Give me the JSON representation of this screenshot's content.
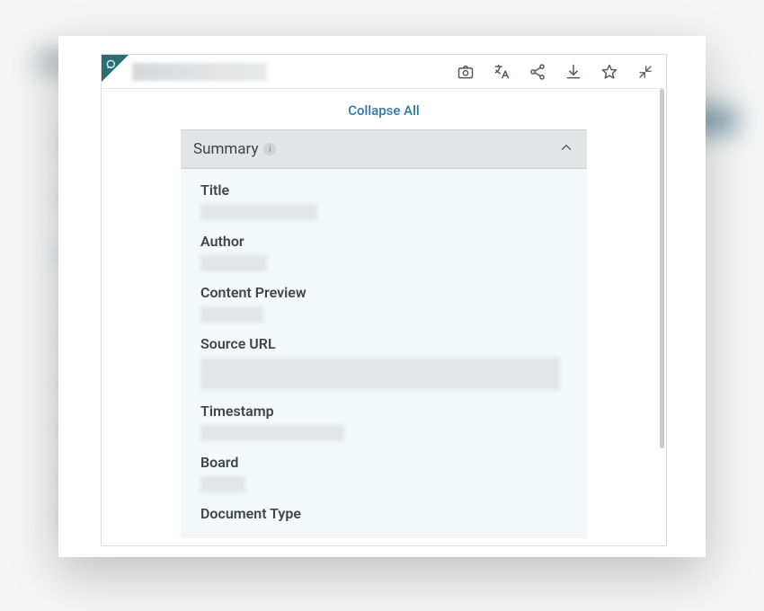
{
  "toolbar": {
    "collapse_label": "Collapse All"
  },
  "section": {
    "title": "Summary",
    "fields": [
      {
        "label": "Title"
      },
      {
        "label": "Author"
      },
      {
        "label": "Content Preview"
      },
      {
        "label": "Source URL"
      },
      {
        "label": "Timestamp"
      },
      {
        "label": "Board"
      },
      {
        "label": "Document Type"
      }
    ]
  },
  "icons": {
    "camera": "camera-icon",
    "translate": "translate-icon",
    "share": "share-icon",
    "download": "download-icon",
    "star": "star-icon",
    "minimize": "minimize-icon"
  }
}
